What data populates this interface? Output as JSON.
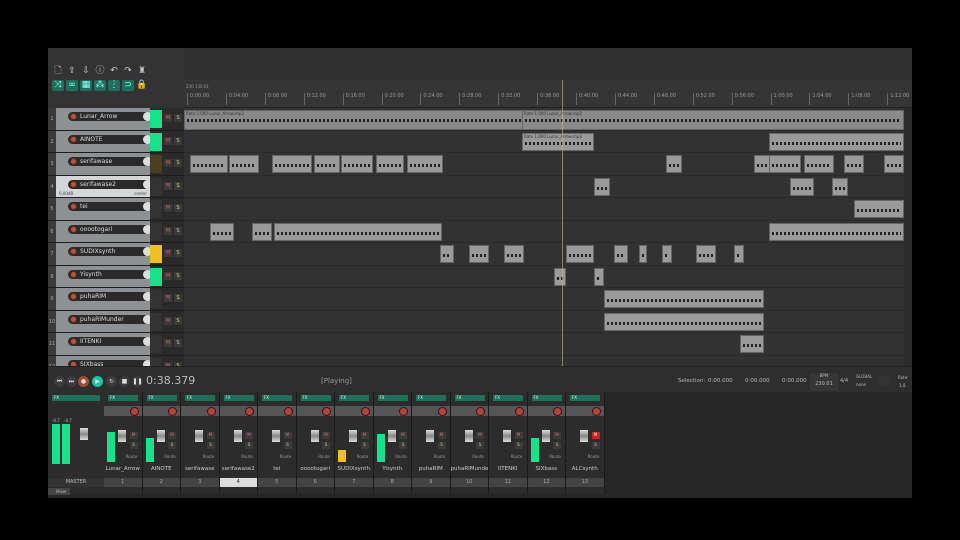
{
  "toolbar": {
    "icons": [
      "new-file",
      "open",
      "save",
      "info",
      "undo",
      "redo",
      "metronome"
    ],
    "toggle_icons": [
      "shuffle",
      "link",
      "grid",
      "snap",
      "ripple",
      "loop"
    ],
    "lock": "lock-icon"
  },
  "ruler": {
    "tempo_marker": "230  130.01",
    "labels": [
      "0:00.00",
      "0:04.00",
      "0:08.00",
      "0:12.00",
      "0:16.00",
      "0:20.00",
      "0:24.00",
      "0:28.00",
      "0:32.00",
      "0:36.00",
      "0:40.00",
      "0:44.00",
      "0:48.00",
      "0:52.00",
      "0:56.00",
      "1:00.00",
      "1:04.00",
      "1:08.00",
      "1:12.00"
    ]
  },
  "tracks": [
    {
      "num": "1",
      "name": "Lunar_Arrow"
    },
    {
      "num": "2",
      "name": "AINOTE"
    },
    {
      "num": "3",
      "name": "serifawase"
    },
    {
      "num": "4",
      "name": "serifawase2",
      "vol": "0.00dB",
      "pan": "center"
    },
    {
      "num": "5",
      "name": "tei"
    },
    {
      "num": "6",
      "name": "ooootogari"
    },
    {
      "num": "7",
      "name": "SUDIXsynth"
    },
    {
      "num": "8",
      "name": "Yisynth"
    },
    {
      "num": "9",
      "name": "puhaRIM"
    },
    {
      "num": "10",
      "name": "puhaRIMunder"
    },
    {
      "num": "11",
      "name": "IITENKI"
    },
    {
      "num": "12",
      "name": "SIXbass"
    }
  ],
  "items": {
    "lunar1": "Rate 1.000 Lunar_Arrow.mp3",
    "lunar2": "Rate 1.000 Lunar_Arrow.mp3"
  },
  "ms": {
    "m": "M",
    "s": "S"
  },
  "transport": {
    "time": "0:38.379",
    "status": "[Playing]",
    "selection_label": "Selection:",
    "sel_start": "0:00.000",
    "sel_end": "0:00.000",
    "sel_len": "0:00.000",
    "bpm_label": "BPM",
    "bpm": "230.01",
    "sig": "4/4",
    "global": "GLOBAL",
    "none": "none",
    "rate_label": "Rate:",
    "rate": "1.0"
  },
  "mixer": {
    "fx": "FX",
    "master": "MASTER",
    "master_db": [
      "-0.7",
      "-0.7"
    ],
    "route": "Route",
    "tab": "Mixer",
    "strips": [
      {
        "n": "1",
        "name": "Lunar_Arrow",
        "lvl": 0.75
      },
      {
        "n": "2",
        "name": "AINOTE",
        "lvl": 0.6
      },
      {
        "n": "3",
        "name": "serifawase",
        "lvl": 0
      },
      {
        "n": "4",
        "name": "serifawase2",
        "lvl": 0
      },
      {
        "n": "5",
        "name": "tei",
        "lvl": 0
      },
      {
        "n": "6",
        "name": "ooootogari",
        "lvl": 0
      },
      {
        "n": "7",
        "name": "SUDIXsynth",
        "lvl": 0.3
      },
      {
        "n": "8",
        "name": "Yisynth",
        "lvl": 0.7
      },
      {
        "n": "9",
        "name": "puhaRIM",
        "lvl": 0
      },
      {
        "n": "10",
        "name": "puhaRIMunde",
        "lvl": 0
      },
      {
        "n": "11",
        "name": "IITENKI",
        "lvl": 0
      },
      {
        "n": "12",
        "name": "SIXbass",
        "lvl": 0.6
      },
      {
        "n": "13",
        "name": "ALCsynth",
        "lvl": 0
      }
    ]
  },
  "colors": {
    "accent": "#19e08a",
    "record": "#b0553f",
    "yellow": "#f0c020"
  }
}
